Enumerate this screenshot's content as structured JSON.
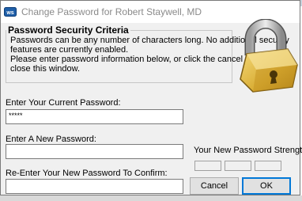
{
  "window": {
    "title": "Change Password for Robert Staywell, MD"
  },
  "criteria": {
    "heading": "Password Security Criteria",
    "lines": [
      "Passwords can be any number of characters long. No additional security",
      "features are currently enabled.",
      "Please enter password information below, or click the cancel button to",
      "close this window."
    ]
  },
  "fields": {
    "current_label": "Enter Your Current Password:",
    "current_value": "*****",
    "new_label": "Enter A New Password:",
    "new_value": "",
    "confirm_label": "Re-Enter Your New Password To Confirm:",
    "confirm_value": ""
  },
  "strength": {
    "label": "Your New Password Strength",
    "level": 0
  },
  "buttons": {
    "cancel": "Cancel",
    "ok": "OK"
  },
  "icons": {
    "app": "app-logo-icon",
    "lock": "padlock-icon"
  }
}
